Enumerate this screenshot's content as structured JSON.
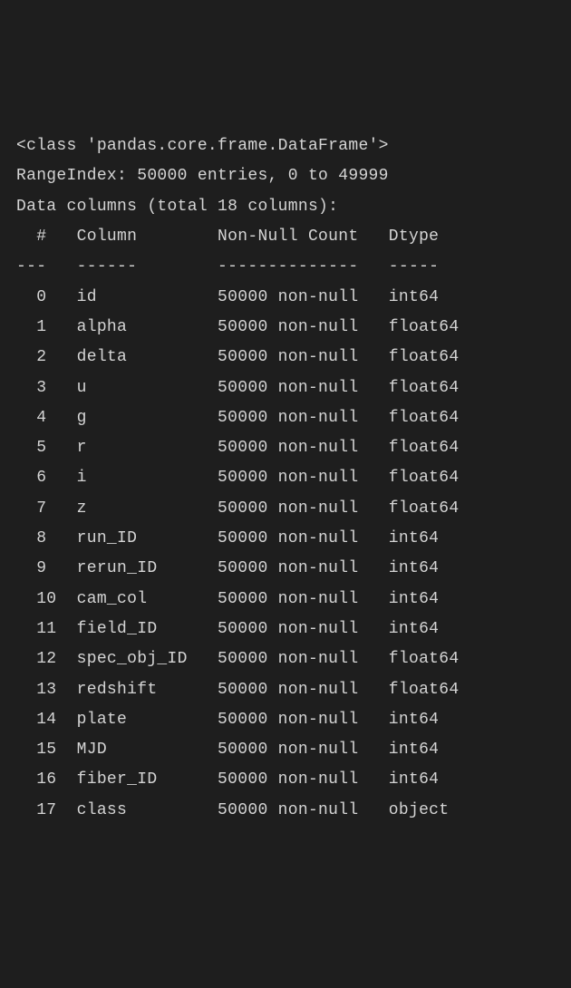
{
  "header": {
    "class_line": "<class 'pandas.core.frame.DataFrame'>",
    "rangeindex_line": "RangeIndex: 50000 entries, 0 to 49999",
    "columns_line": "Data columns (total 18 columns):"
  },
  "table_header": {
    "idx": " # ",
    "col": "Column",
    "nn": "Non-Null Count",
    "dtype": "Dtype"
  },
  "table_divider": {
    "idx": "---",
    "col": "------",
    "nn": "--------------",
    "dtype": "-----"
  },
  "columns": [
    {
      "idx": " 0 ",
      "name": "id",
      "nn": "50000 non-null",
      "dtype": "int64"
    },
    {
      "idx": " 1 ",
      "name": "alpha",
      "nn": "50000 non-null",
      "dtype": "float64"
    },
    {
      "idx": " 2 ",
      "name": "delta",
      "nn": "50000 non-null",
      "dtype": "float64"
    },
    {
      "idx": " 3 ",
      "name": "u",
      "nn": "50000 non-null",
      "dtype": "float64"
    },
    {
      "idx": " 4 ",
      "name": "g",
      "nn": "50000 non-null",
      "dtype": "float64"
    },
    {
      "idx": " 5 ",
      "name": "r",
      "nn": "50000 non-null",
      "dtype": "float64"
    },
    {
      "idx": " 6 ",
      "name": "i",
      "nn": "50000 non-null",
      "dtype": "float64"
    },
    {
      "idx": " 7 ",
      "name": "z",
      "nn": "50000 non-null",
      "dtype": "float64"
    },
    {
      "idx": " 8 ",
      "name": "run_ID",
      "nn": "50000 non-null",
      "dtype": "int64"
    },
    {
      "idx": " 9 ",
      "name": "rerun_ID",
      "nn": "50000 non-null",
      "dtype": "int64"
    },
    {
      "idx": " 10",
      "name": "cam_col",
      "nn": "50000 non-null",
      "dtype": "int64"
    },
    {
      "idx": " 11",
      "name": "field_ID",
      "nn": "50000 non-null",
      "dtype": "int64"
    },
    {
      "idx": " 12",
      "name": "spec_obj_ID",
      "nn": "50000 non-null",
      "dtype": "float64"
    },
    {
      "idx": " 13",
      "name": "redshift",
      "nn": "50000 non-null",
      "dtype": "float64"
    },
    {
      "idx": " 14",
      "name": "plate",
      "nn": "50000 non-null",
      "dtype": "int64"
    },
    {
      "idx": " 15",
      "name": "MJD",
      "nn": "50000 non-null",
      "dtype": "int64"
    },
    {
      "idx": " 16",
      "name": "fiber_ID",
      "nn": "50000 non-null",
      "dtype": "int64"
    },
    {
      "idx": " 17",
      "name": "class",
      "nn": "50000 non-null",
      "dtype": "object"
    }
  ],
  "widths": {
    "idx": 3,
    "name": 12,
    "nn": 15,
    "dtype": 8
  }
}
